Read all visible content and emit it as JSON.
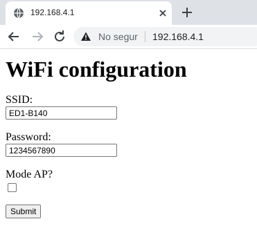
{
  "browser": {
    "tab_title": "192.168.4.1",
    "security_label": "No segur",
    "url": "192.168.4.1"
  },
  "page": {
    "title": "WiFi configuration",
    "ssid_label": "SSID:",
    "ssid_value": "ED1-B140",
    "password_label": "Password:",
    "password_value": "1234567890",
    "mode_ap_label": "Mode AP?",
    "mode_ap_checked": false,
    "submit_label": "Submit"
  }
}
